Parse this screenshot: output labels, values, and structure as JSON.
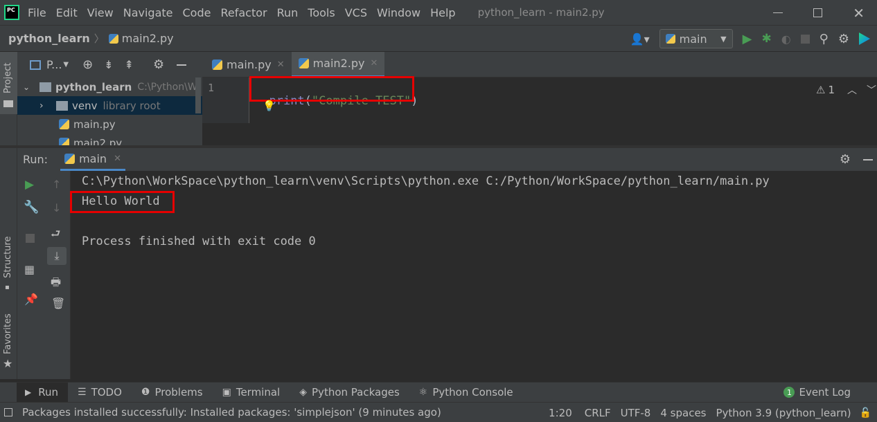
{
  "app": {
    "logo_text": "PC",
    "window_title": "python_learn - main2.py"
  },
  "menu": [
    "File",
    "Edit",
    "View",
    "Navigate",
    "Code",
    "Refactor",
    "Run",
    "Tools",
    "VCS",
    "Window",
    "Help"
  ],
  "breadcrumb": {
    "project": "python_learn",
    "file": "main2.py"
  },
  "run_config": {
    "selected": "main"
  },
  "side_tabs": {
    "project": "Project",
    "structure": "Structure",
    "favorites": "Favorites"
  },
  "project_panel": {
    "header_label": "P...",
    "root": {
      "name": "python_learn",
      "path": "C:\\Python\\W"
    },
    "items": [
      {
        "name": "venv",
        "hint": "library root"
      },
      {
        "name": "main.py"
      },
      {
        "name": "main2.py"
      }
    ]
  },
  "editor": {
    "tabs": [
      {
        "label": "main.py"
      },
      {
        "label": "main2.py"
      }
    ],
    "line_number": "1",
    "code": {
      "func": "print",
      "open": "(",
      "string": "\"Compile TEST\"",
      "close": ")"
    },
    "inspection_count": "1"
  },
  "run_panel": {
    "label": "Run:",
    "tab": "main",
    "output": [
      "C:\\Python\\WorkSpace\\python_learn\\venv\\Scripts\\python.exe C:/Python/WorkSpace/python_learn/main.py",
      "Hello World",
      "",
      "Process finished with exit code 0"
    ]
  },
  "bottom_tabs": [
    "Run",
    "TODO",
    "Problems",
    "Terminal",
    "Python Packages",
    "Python Console"
  ],
  "event_log": {
    "label": "Event Log",
    "count": "1"
  },
  "status": {
    "message": "Packages installed successfully: Installed packages: 'simplejson' (9 minutes ago)",
    "position": "1:20",
    "line_sep": "CRLF",
    "encoding": "UTF-8",
    "indent": "4 spaces",
    "interpreter": "Python 3.9 (python_learn)"
  },
  "colors": {
    "accent_green": "#499c54",
    "highlight_red": "#e60000",
    "code_func": "#8888c6",
    "code_string": "#6a8759"
  }
}
